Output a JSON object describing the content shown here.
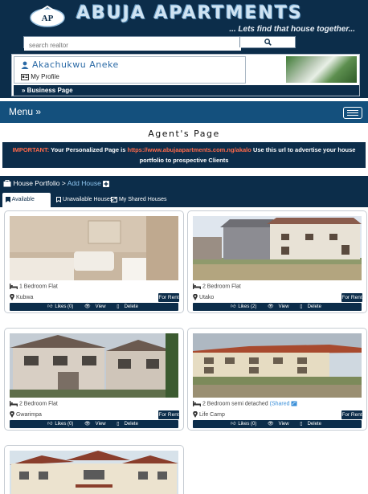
{
  "header": {
    "logo_text": "AP",
    "brand": "ABUJA APARTMENTS",
    "tagline": "... Lets find that house together...",
    "search": {
      "placeholder": "search realtor"
    }
  },
  "user": {
    "name": "Akachukwu Aneke",
    "profile_label": "My Profile",
    "business_label": "» Business Page"
  },
  "menu": {
    "label": "Menu »"
  },
  "agent": {
    "title": "Agent's Page",
    "notice_important": "IMPORTANT:",
    "notice_text1": "Your Personalized Page is",
    "notice_url": "https://www.abujaapartments.com.ng/akalo",
    "notice_text2": "Use this url to advertise your house portfolio to prospective Clients"
  },
  "portfolio": {
    "title": "House Portfolio",
    "separator": ">",
    "add": "Add House",
    "tabs": [
      "Available Houses",
      "Unavailable Houses",
      "My Shared Houses"
    ]
  },
  "listings": [
    {
      "type": "1 Bedroom Flat",
      "location": "Kubwa",
      "status": "For Rent",
      "likes": "Likes (0)",
      "view": "View",
      "delete": "Delete",
      "shared": ""
    },
    {
      "type": "2 Bedroom Flat",
      "location": "Utako",
      "status": "For Rent",
      "likes": "Likes (2)",
      "view": "View",
      "delete": "Delete",
      "shared": ""
    },
    {
      "type": "2 Bedroom Flat",
      "location": "Gwarimpa",
      "status": "For Rent",
      "likes": "Likes (0)",
      "view": "View",
      "delete": "Delete",
      "shared": ""
    },
    {
      "type": "2 Bedroom semi detached",
      "location": "Life Camp",
      "status": "For Rent",
      "likes": "Likes (0)",
      "view": "View",
      "delete": "Delete",
      "shared": "(Shared"
    }
  ],
  "colors": {
    "navy": "#0c2d4a",
    "menu_blue": "#14507d",
    "important_red": "#ff6a4a",
    "link_blue": "#2b6aa6"
  }
}
